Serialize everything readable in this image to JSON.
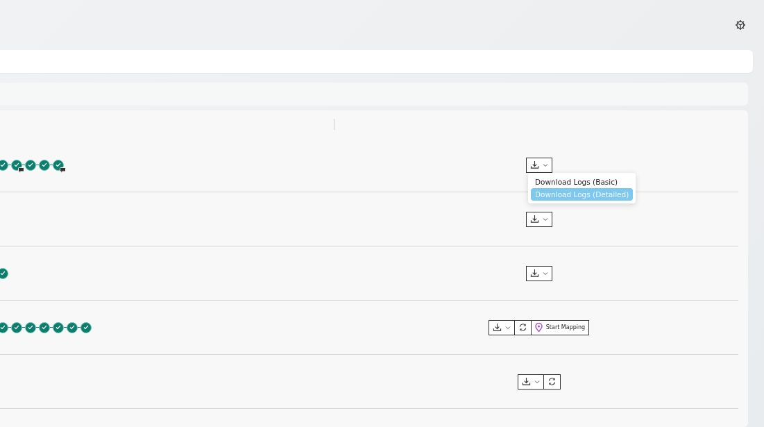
{
  "rows": [
    {
      "steps": [
        {
          "comment": false
        },
        {
          "comment": true
        },
        {
          "comment": false
        },
        {
          "comment": false
        },
        {
          "comment": true
        }
      ],
      "actions": [
        {
          "kind": "download"
        }
      ],
      "menu": {
        "items": [
          {
            "label": "Download Logs (Basic)",
            "selected": false
          },
          {
            "label": "Download Logs (Detailed)",
            "selected": true
          }
        ]
      }
    },
    {
      "steps": [],
      "actions": [
        {
          "kind": "download"
        }
      ]
    },
    {
      "steps": [
        {
          "comment": false
        }
      ],
      "actions": [
        {
          "kind": "download"
        }
      ]
    },
    {
      "steps": [
        {
          "comment": false
        },
        {
          "comment": false
        },
        {
          "comment": false
        },
        {
          "comment": false
        },
        {
          "comment": false
        },
        {
          "comment": false
        },
        {
          "comment": false
        }
      ],
      "actions": [
        {
          "kind": "download"
        },
        {
          "kind": "refresh"
        },
        {
          "kind": "mapping",
          "label": "Start Mapping"
        }
      ]
    },
    {
      "steps": [],
      "actions": [
        {
          "kind": "download"
        },
        {
          "kind": "refresh"
        }
      ]
    }
  ]
}
